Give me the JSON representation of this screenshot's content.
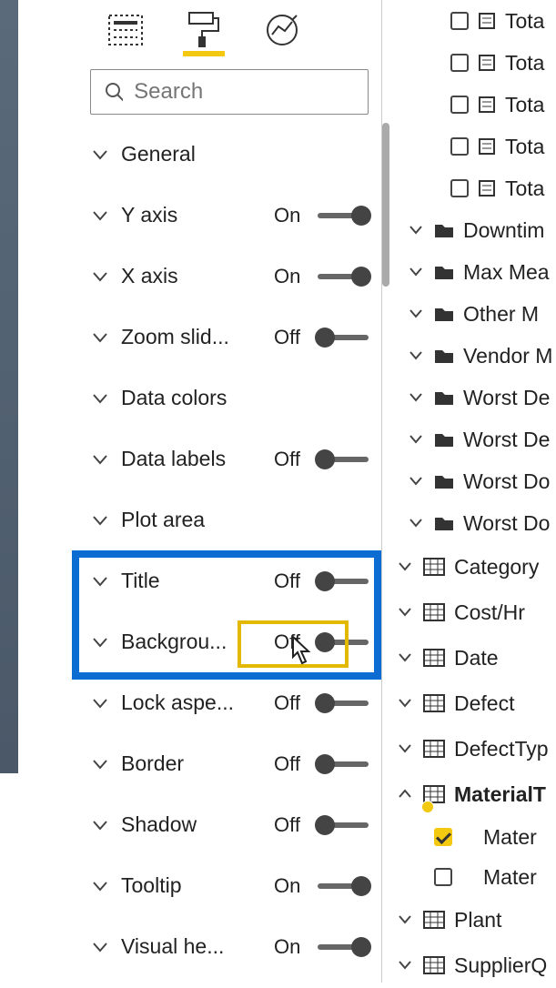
{
  "search": {
    "placeholder": "Search"
  },
  "labels": {
    "on": "On",
    "off": "Off"
  },
  "format_rows": {
    "general": {
      "label": "General"
    },
    "yaxis": {
      "label": "Y axis"
    },
    "xaxis": {
      "label": "X axis"
    },
    "zoom": {
      "label": "Zoom slid..."
    },
    "datacolors": {
      "label": "Data colors"
    },
    "datalabels": {
      "label": "Data labels"
    },
    "plotarea": {
      "label": "Plot area"
    },
    "title": {
      "label": "Title"
    },
    "background": {
      "label": "Backgrou..."
    },
    "lockaspect": {
      "label": "Lock aspe..."
    },
    "border": {
      "label": "Border"
    },
    "shadow": {
      "label": "Shadow"
    },
    "tooltip": {
      "label": "Tooltip"
    },
    "visualhead": {
      "label": "Visual he..."
    }
  },
  "fields": {
    "tota1": "Tota",
    "tota2": "Tota",
    "tota3": "Tota",
    "tota4": "Tota",
    "tota5": "Tota",
    "downtime": "Downtim",
    "maxmea": "Max Mea",
    "otherm": "Other M",
    "vendorm": "Vendor M",
    "worstd1": "Worst De",
    "worstd2": "Worst De",
    "worstd3": "Worst Do",
    "worstd4": "Worst Do",
    "category": "Category",
    "costhr": "Cost/Hr",
    "date": "Date",
    "defect": "Defect",
    "defecttype": "DefectTyp",
    "materialt": "MaterialT",
    "mater1": "Mater",
    "mater2": "Mater",
    "plant": "Plant",
    "supplierq": "SupplierQ"
  }
}
